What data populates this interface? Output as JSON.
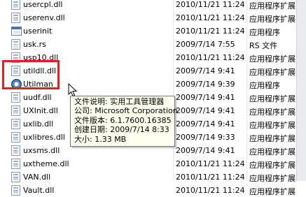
{
  "files": [
    {
      "name": "usercpl.dll",
      "date": "2010/11/21 11:24",
      "type": "应用程序扩展",
      "icon": "dll-file-icon"
    },
    {
      "name": "userenv.dll",
      "date": "2010/11/21 11:24",
      "type": "应用程序扩展",
      "icon": "dll-file-icon"
    },
    {
      "name": "userinit",
      "date": "2010/11/21 11:24",
      "type": "应用程序",
      "icon": "exe-file-icon"
    },
    {
      "name": "usk.rs",
      "date": "2009/7/14 7:55",
      "type": "RS 文件",
      "icon": "text-file-icon"
    },
    {
      "name": "usp10.dll",
      "date": "2010/11/21 11:24",
      "type": "应用程序扩展",
      "icon": "dll-file-icon"
    },
    {
      "name": "utildll.dll",
      "date": "2009/7/14 9:41",
      "type": "应用程序扩展",
      "icon": "dll-file-icon"
    },
    {
      "name": "Utilman",
      "date": "2009/7/14 9:39",
      "type": "应用程序",
      "icon": "utilman-gear-icon"
    },
    {
      "name": "uudf.dll",
      "date": "2009/7/14 9:41",
      "type": "应用程序扩展",
      "icon": "dll-file-icon"
    },
    {
      "name": "UXInit.dll",
      "date": "2009/7/14 9:41",
      "type": "应用程序扩展",
      "icon": "dll-file-icon"
    },
    {
      "name": "uxlib.dll",
      "date": "2009/7/14 9:41",
      "type": "应用程序扩展",
      "icon": "dll-file-icon"
    },
    {
      "name": "uxlibres.dll",
      "date": "2009/7/14 9:33",
      "type": "应用程序扩展",
      "icon": "dll-file-icon"
    },
    {
      "name": "uxsms.dll",
      "date": "2009/7/14 9:41",
      "type": "应用程序扩展",
      "icon": "dll-file-icon"
    },
    {
      "name": "uxtheme.dll",
      "date": "2010/11/21 11:24",
      "type": "应用程序扩展",
      "icon": "dll-file-icon"
    },
    {
      "name": "VAN.dll",
      "date": "2010/11/21 11:24",
      "type": "应用程序扩展",
      "icon": "dll-file-icon"
    },
    {
      "name": "Vault.dll",
      "date": "2010/11/21 11:24",
      "type": "应用程序扩展",
      "icon": "dll-file-icon"
    }
  ],
  "tooltip": {
    "description": "文件说明: 实用工具管理器",
    "company": "公司: Microsoft Corporation",
    "version": "文件版本: 6.1.7600.16385",
    "created": "创建日期: 2009/7/14 8:33",
    "size": "大小: 1.33 MB"
  },
  "highlight_color": "#e02020",
  "tooltip_bg": "#fffff0"
}
